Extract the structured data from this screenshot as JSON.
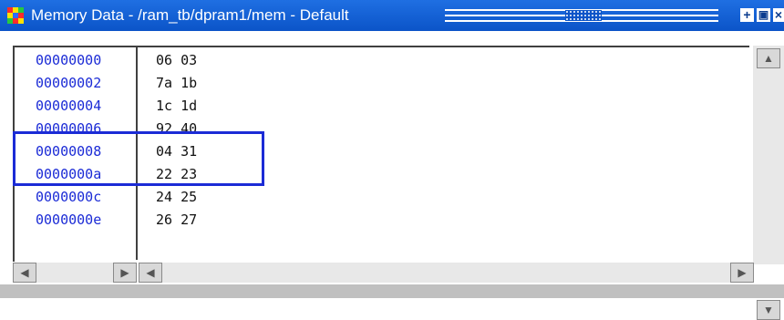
{
  "window": {
    "title": "Memory Data - /ram_tb/dpram1/mem - Default",
    "icon": "app-grid-icon",
    "buttons": {
      "add": "+",
      "restore": "▣",
      "close": "×"
    }
  },
  "memory": {
    "rows": [
      {
        "address": "00000000",
        "values": "06 03"
      },
      {
        "address": "00000002",
        "values": "7a 1b"
      },
      {
        "address": "00000004",
        "values": "1c 1d"
      },
      {
        "address": "00000006",
        "values": "92 40"
      },
      {
        "address": "00000008",
        "values": "04 31"
      },
      {
        "address": "0000000a",
        "values": "22 23"
      },
      {
        "address": "0000000c",
        "values": "24 25"
      },
      {
        "address": "0000000e",
        "values": "26 27"
      }
    ],
    "highlighted_rows": [
      "00000006",
      "00000008"
    ],
    "address_color": "#1b2bd6",
    "highlight_color": "#1b2bd6"
  },
  "scrollbars": {
    "vertical": {
      "up": "▲",
      "down": "▼"
    },
    "horizontal_left": {
      "left": "◀",
      "right": "▶"
    },
    "horizontal_right": {
      "left": "◀",
      "right": "▶"
    }
  }
}
